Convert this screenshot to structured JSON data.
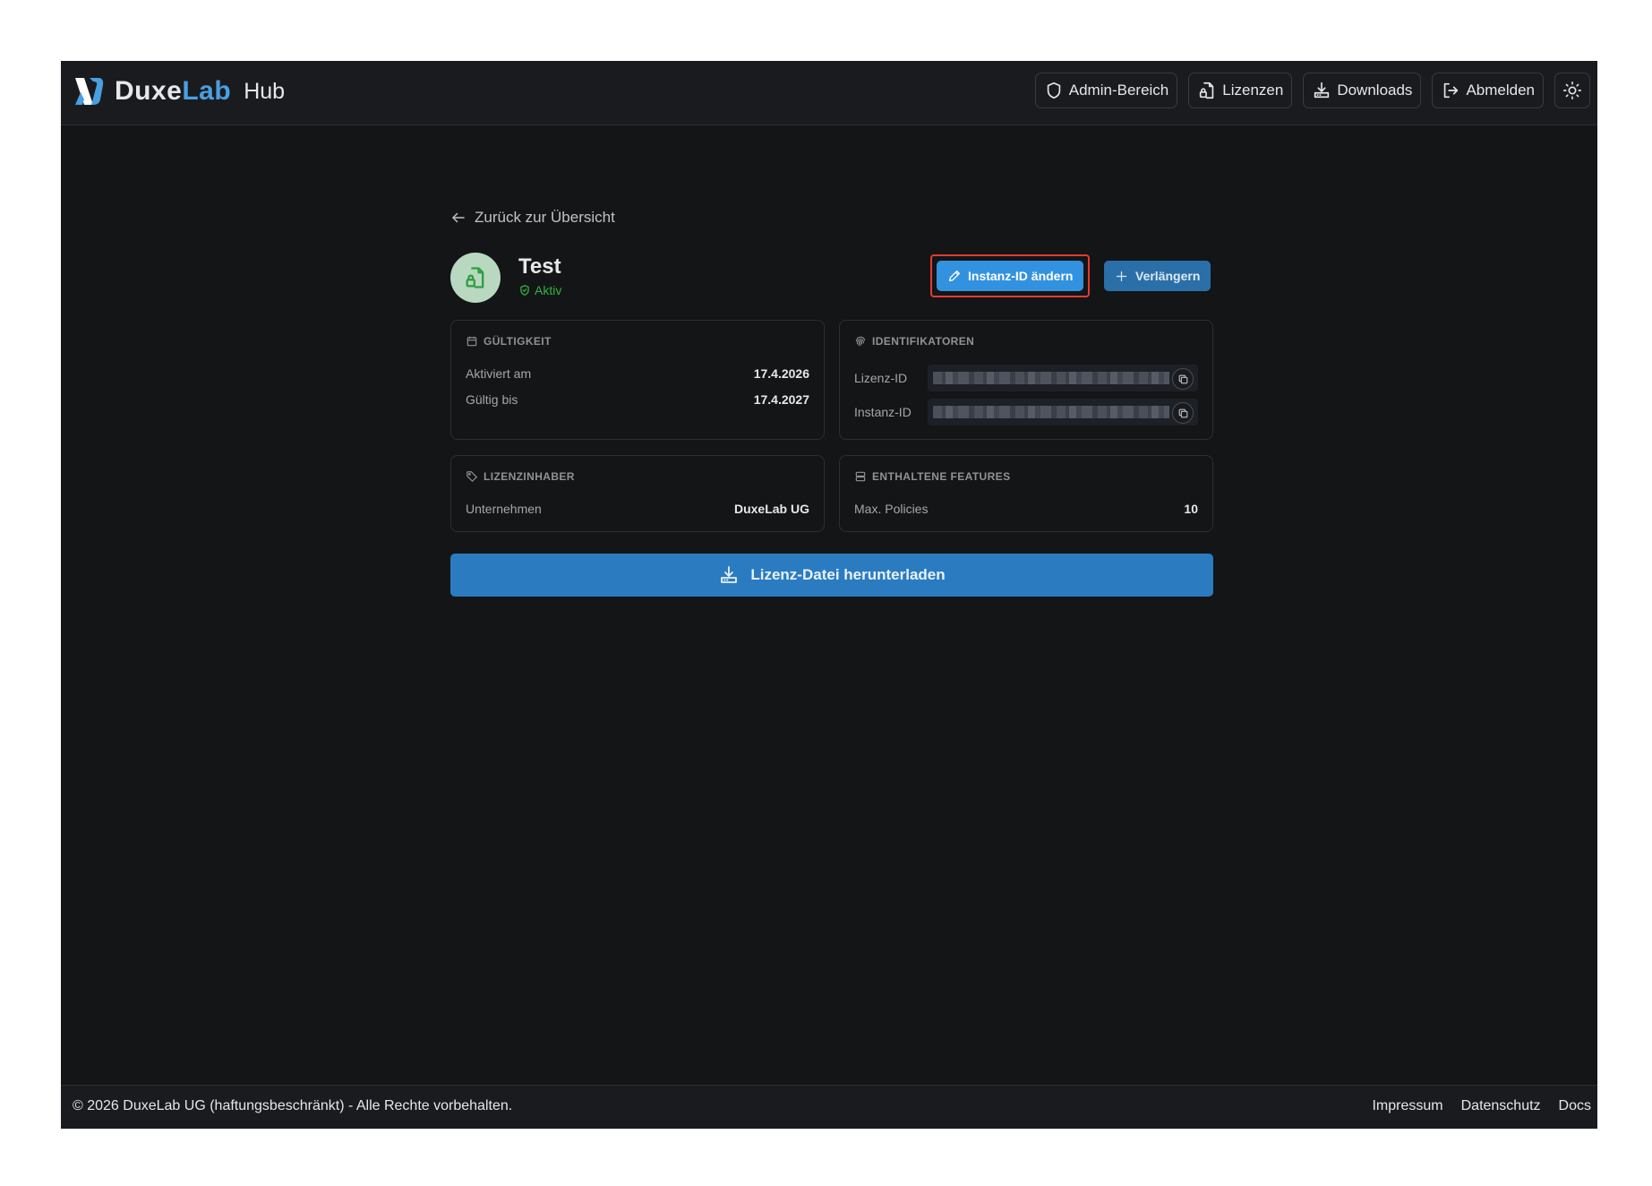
{
  "header": {
    "brand_name_prefix": "Duxe",
    "brand_name_suffix": "Lab",
    "brand_product": "Hub",
    "nav": {
      "admin": "Admin-Bereich",
      "licenses": "Lizenzen",
      "downloads": "Downloads",
      "logout": "Abmelden"
    },
    "theme_toggle_icon": "sun-icon"
  },
  "main": {
    "back_link": "Zurück zur Übersicht",
    "license": {
      "title": "Test",
      "status": "Aktiv",
      "status_color": "#2fb344"
    },
    "actions": {
      "change_instance": "Instanz-ID ändern",
      "renew": "Verlängern"
    },
    "validity": {
      "heading": "Gültigkeit",
      "activated_label": "Aktiviert am",
      "activated_value": "17.4.2026",
      "valid_until_label": "Gültig bis",
      "valid_until_value": "17.4.2027"
    },
    "identifiers": {
      "heading": "Identifikatoren",
      "license_id_label": "Lizenz-ID",
      "instance_id_label": "Instanz-ID"
    },
    "holder": {
      "heading": "Lizenzinhaber",
      "company_label": "Unternehmen",
      "company_value": "DuxeLab UG"
    },
    "features": {
      "heading": "Enthaltene Features",
      "max_policies_label": "Max. Policies",
      "max_policies_value": "10"
    },
    "download_button": "Lizenz-Datei herunterladen"
  },
  "footer": {
    "copyright": "© 2026 DuxeLab UG (haftungsbeschränkt) - Alle Rechte vorbehalten.",
    "links": {
      "impressum": "Impressum",
      "datenschutz": "Datenschutz",
      "docs": "Docs"
    }
  },
  "colors": {
    "accent": "#3392df",
    "highlight_outline": "#e03c31",
    "background": "#141517"
  }
}
